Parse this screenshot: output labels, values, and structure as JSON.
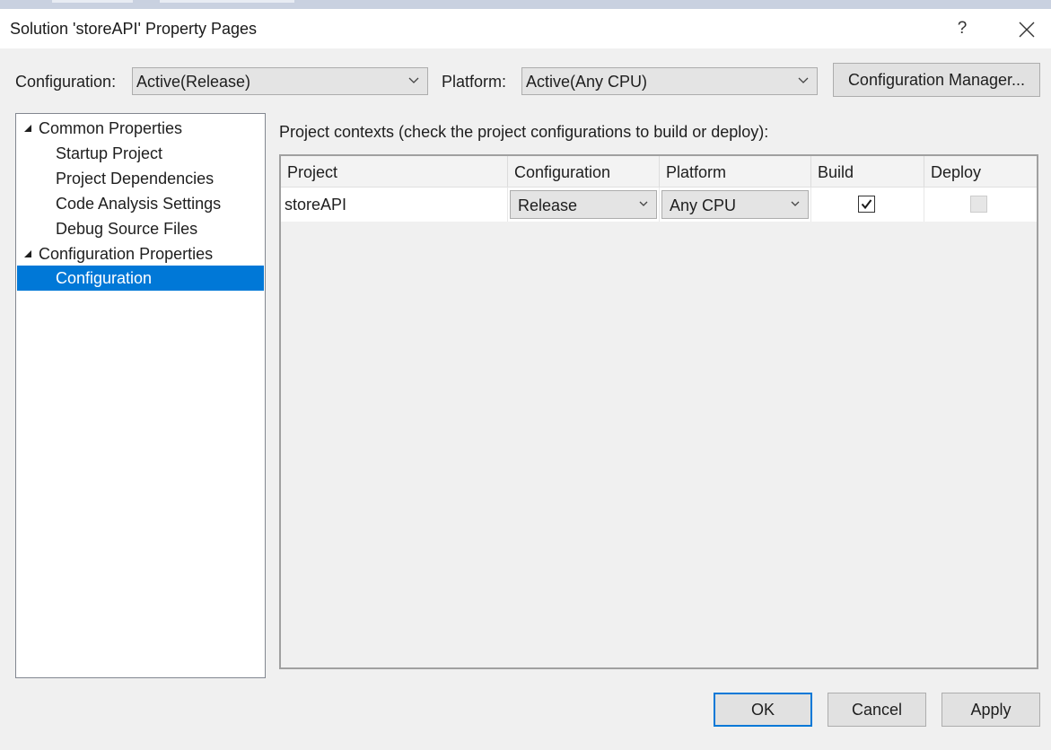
{
  "window": {
    "title": "Solution 'storeAPI' Property Pages",
    "help_label": "?"
  },
  "toolbar": {
    "configuration_label": "Configuration:",
    "configuration_value": "Active(Release)",
    "platform_label": "Platform:",
    "platform_value": "Active(Any CPU)",
    "config_manager_label": "Configuration Manager..."
  },
  "tree": {
    "items": [
      {
        "label": "Common Properties",
        "expanded": true
      },
      {
        "label": "Startup Project"
      },
      {
        "label": "Project Dependencies"
      },
      {
        "label": "Code Analysis Settings"
      },
      {
        "label": "Debug Source Files"
      },
      {
        "label": "Configuration Properties",
        "expanded": true
      },
      {
        "label": "Configuration",
        "selected": true
      }
    ]
  },
  "main": {
    "contexts_label": "Project contexts (check the project configurations to build or deploy):",
    "columns": [
      "Project",
      "Configuration",
      "Platform",
      "Build",
      "Deploy"
    ],
    "rows": [
      {
        "project": "storeAPI",
        "configuration": "Release",
        "platform": "Any CPU",
        "build": true,
        "deploy": false
      }
    ]
  },
  "footer": {
    "ok_label": "OK",
    "cancel_label": "Cancel",
    "apply_label": "Apply"
  },
  "colors": {
    "accent": "#0078d7",
    "dialog_bg": "#f0f0f0"
  }
}
